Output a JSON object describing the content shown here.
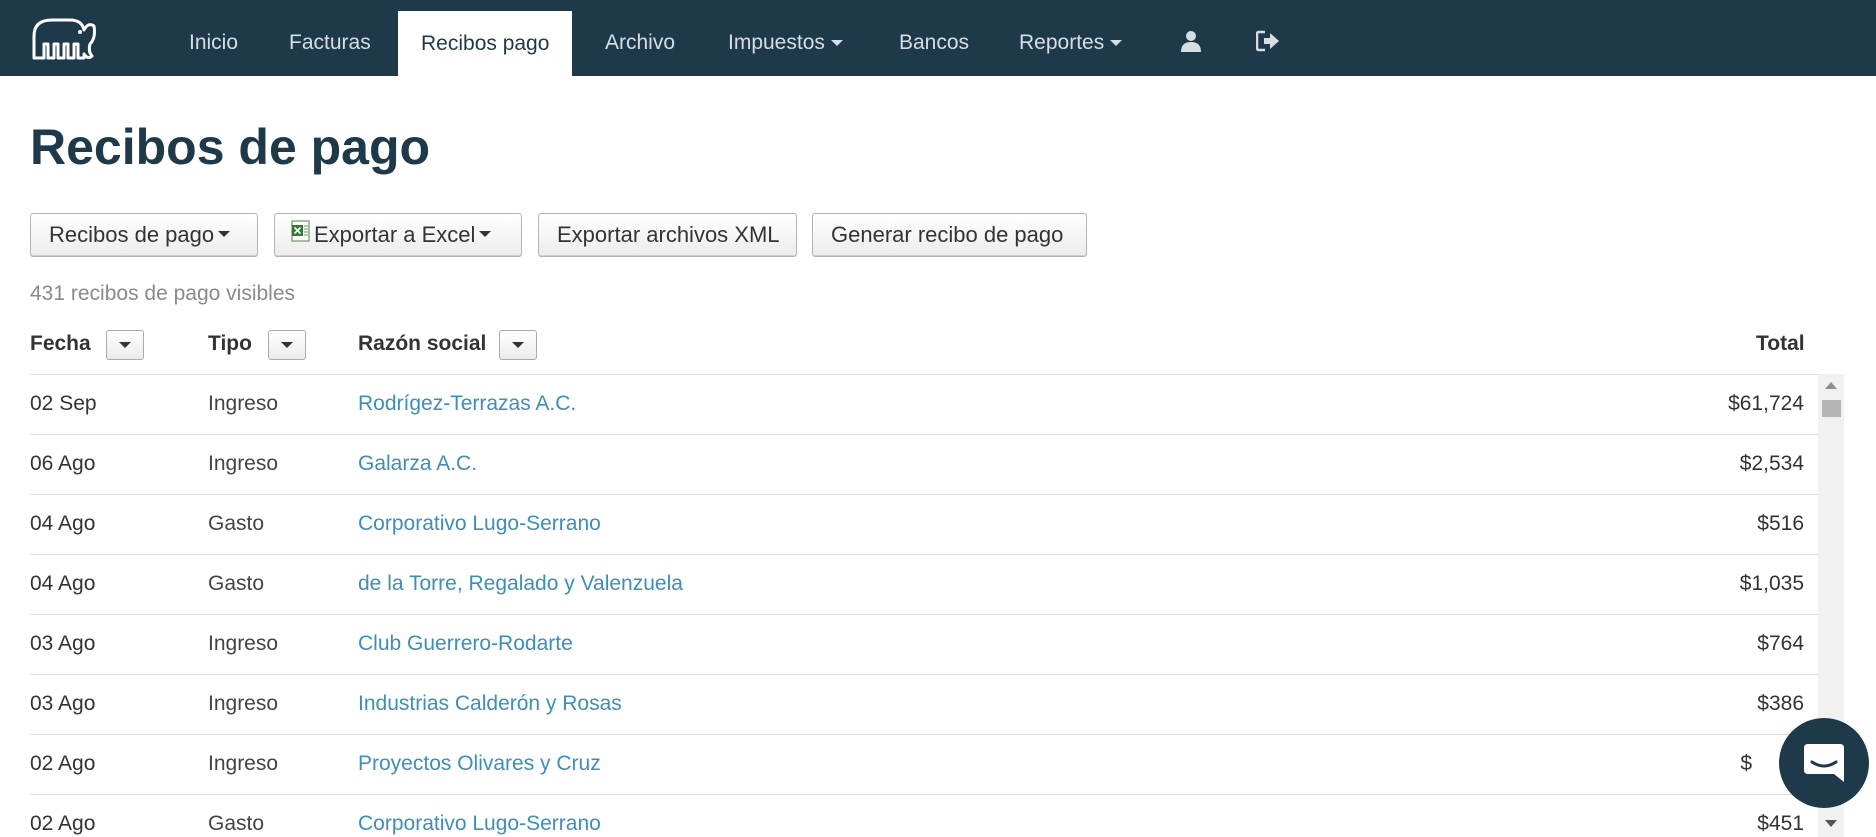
{
  "nav": {
    "items": [
      {
        "label": "Inicio"
      },
      {
        "label": "Facturas"
      },
      {
        "label": "Recibos pago"
      },
      {
        "label": "Archivo"
      },
      {
        "label": "Impuestos"
      },
      {
        "label": "Bancos"
      },
      {
        "label": "Reportes"
      }
    ],
    "active_item": "Recibos pago",
    "icons": [
      "elephant-logo-icon",
      "user-icon",
      "sign-out-icon"
    ]
  },
  "page": {
    "title": "Recibos de pago"
  },
  "toolbar": {
    "filter_label": "Recibos de pago",
    "export_excel_label": "Exportar a Excel",
    "export_xml_label": "Exportar archivos XML",
    "generate_label": "Generar recibo de pago"
  },
  "summary": {
    "count_text": "431 recibos de pago visibles"
  },
  "table": {
    "headers": {
      "fecha": "Fecha",
      "tipo": "Tipo",
      "razon": "Razón social",
      "total": "Total"
    },
    "rows": [
      {
        "fecha": "02 Sep",
        "tipo": "Ingreso",
        "razon": "Rodrígez-Terrazas A.C.",
        "total": "$61,724"
      },
      {
        "fecha": "06 Ago",
        "tipo": "Ingreso",
        "razon": "Galarza A.C.",
        "total": "$2,534"
      },
      {
        "fecha": "04 Ago",
        "tipo": "Gasto",
        "razon": "Corporativo Lugo-Serrano",
        "total": "$516"
      },
      {
        "fecha": "04 Ago",
        "tipo": "Gasto",
        "razon": "de la Torre, Regalado y Valenzuela",
        "total": "$1,035"
      },
      {
        "fecha": "03 Ago",
        "tipo": "Ingreso",
        "razon": "Club Guerrero-Rodarte",
        "total": "$764"
      },
      {
        "fecha": "03 Ago",
        "tipo": "Ingreso",
        "razon": "Industrias Calderón y Rosas",
        "total": "$386"
      },
      {
        "fecha": "02 Ago",
        "tipo": "Ingreso",
        "razon": "Proyectos Olivares y Cruz",
        "total": "$"
      },
      {
        "fecha": "02 Ago",
        "tipo": "Gasto",
        "razon": "Corporativo Lugo-Serrano",
        "total": "$451"
      }
    ]
  },
  "colors": {
    "navbar_bg": "#1e3a4a",
    "link": "#3a8fbf",
    "title": "#1e3a4a"
  },
  "chat": {
    "icon": "chat-bubble-icon"
  }
}
